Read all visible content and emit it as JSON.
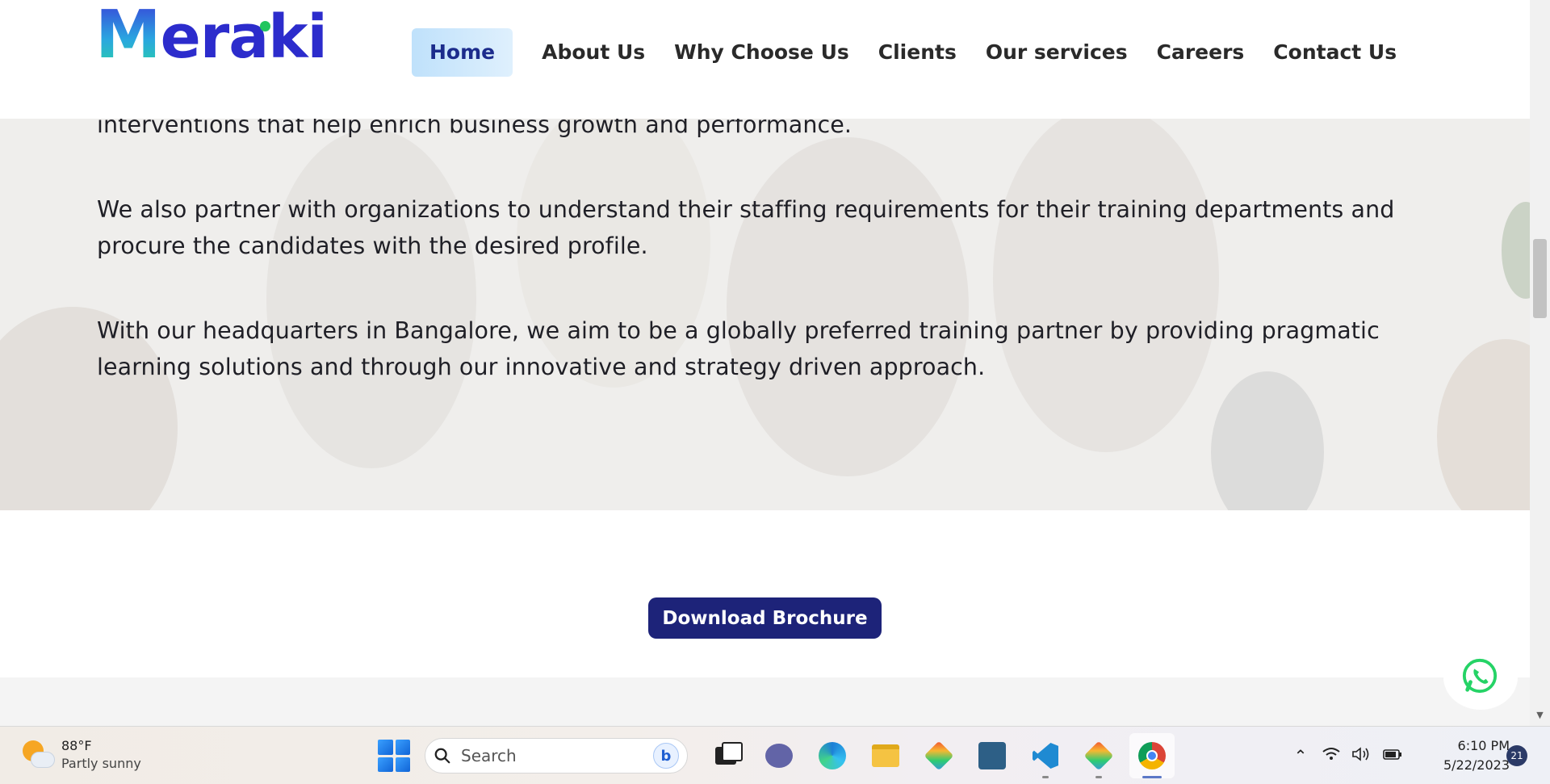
{
  "brand": {
    "name": "Meraki",
    "first_letter": "M",
    "rest": "eraki"
  },
  "nav": {
    "items": [
      {
        "label": "Home",
        "active": true
      },
      {
        "label": "About Us"
      },
      {
        "label": "Why Choose Us"
      },
      {
        "label": "Clients"
      },
      {
        "label": "Our services"
      },
      {
        "label": "Careers"
      },
      {
        "label": "Contact Us"
      }
    ]
  },
  "content": {
    "paragraphs": [
      "We specialize in addressing the skills gap of employees to resolute competency based - learning programs and interventions that help enrich business growth and performance.",
      "We also partner with organizations to understand their staffing requirements for their training departments and procure the candidates with the desired profile.",
      "With our headquarters in Bangalore, we aim to be a globally preferred training partner by providing pragmatic learning solutions and through our innovative and strategy driven approach."
    ]
  },
  "cta": {
    "label": "Download Brochure"
  },
  "taskbar": {
    "weather": {
      "temp": "88°F",
      "desc": "Partly sunny"
    },
    "search_placeholder": "Search",
    "bing_glyph": "b",
    "clock": {
      "time": "6:10 PM",
      "date": "5/22/2023"
    },
    "notifications": "21"
  },
  "colors": {
    "brand_blue": "#2c2ccc",
    "cta_bg": "#1d2379",
    "nav_active_bg": "#cfe8fc",
    "whatsapp": "#25d366"
  }
}
